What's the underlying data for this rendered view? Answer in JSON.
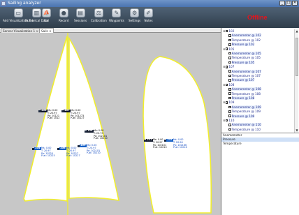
{
  "window": {
    "title": "Sailing analyzer"
  },
  "window_buttons": [
    "_",
    "□",
    "✕"
  ],
  "toolbar": {
    "items": [
      {
        "label": "Add Visualization Tab",
        "icon": "add-tab-icon",
        "glyph": "▭"
      },
      {
        "label": "Numerical Data",
        "icon": "columns-icon",
        "glyph": "▥"
      },
      {
        "label": "Sail",
        "icon": "sail-icon",
        "glyph": "⛵"
      },
      {
        "label": "Record",
        "icon": "record-icon",
        "glyph": "●"
      },
      {
        "label": "Sessions",
        "icon": "sessions-icon",
        "glyph": "▤"
      },
      {
        "label": "Calibration",
        "icon": "calibration-icon",
        "glyph": "⚖"
      },
      {
        "label": "Waypoints",
        "icon": "waypoints-icon",
        "glyph": "✎"
      },
      {
        "label": "Settings",
        "icon": "settings-icon",
        "glyph": "⚙"
      },
      {
        "label": "Notes",
        "icon": "notes-icon",
        "glyph": "✐"
      }
    ],
    "status": "Offline",
    "status_color": "#e8121b"
  },
  "tabs": [
    {
      "label": "Sensor Visualization 1",
      "close": "×",
      "active": false
    },
    {
      "label": "Sails",
      "close": "×",
      "active": true
    }
  ],
  "sail_color": "#f1ee2e",
  "sensors": [
    {
      "id": "105",
      "lines": [
        "Ms: 0.00",
        "T: 20.97",
        "Pa: 10121",
        "P-at: 1012"
      ],
      "highlight": false
    },
    {
      "id": "107",
      "lines": [
        "Ms: 0.00",
        "T: 20.97",
        "Pa: 101273",
        "P-at: 10127"
      ],
      "highlight": false
    },
    {
      "id": "104",
      "lines": [
        "Ms: 0.00",
        "T: 20.97",
        "Pa: 10220",
        "P-at: 10225"
      ],
      "highlight": true
    },
    {
      "id": "106",
      "lines": [
        "Ms: 0.00",
        "T: 20.97",
        "Pa: 10227",
        "P-at: 10227"
      ],
      "highlight": true
    },
    {
      "id": "108",
      "lines": [
        "Ms: 0.00",
        "T: 20.70",
        "Pa: 102101",
        "P-at: 10210"
      ],
      "highlight": false
    },
    {
      "id": "109",
      "lines": [
        "Ms: 0.00",
        "T: 20.97",
        "Pa: 102101",
        "P-at: 10210"
      ],
      "highlight": true
    },
    {
      "id": "101",
      "lines": [
        "Ms: 0.00",
        "T: 20.97",
        "Pa: 102101",
        "P-at: 10210"
      ],
      "highlight": false
    },
    {
      "id": "102",
      "lines": [
        "Ms: 0.00",
        "T: 20.96",
        "Pa: 102166",
        "P-at: 10216"
      ],
      "highlight": true
    }
  ],
  "tree": [
    {
      "text": "102",
      "level": 0,
      "expander": "⊟",
      "sel": false
    },
    {
      "text": "Anemometer @ 102",
      "level": 1,
      "sel": true
    },
    {
      "text": "Temperature @ 102",
      "level": 1,
      "sel": false
    },
    {
      "text": "Pressure @ 102",
      "level": 1,
      "sel": true
    },
    {
      "text": "105",
      "level": 0,
      "expander": "⊟",
      "sel": false
    },
    {
      "text": "Anemometer @ 105",
      "level": 1,
      "sel": true
    },
    {
      "text": "Temperature @ 105",
      "level": 1,
      "sel": false
    },
    {
      "text": "Pressure @ 105",
      "level": 1,
      "sel": true
    },
    {
      "text": "107",
      "level": 0,
      "expander": "⊟",
      "sel": false
    },
    {
      "text": "Anemometer @ 107",
      "level": 1,
      "sel": true
    },
    {
      "text": "Temperature @ 107",
      "level": 1,
      "sel": false
    },
    {
      "text": "Pressure @ 107",
      "level": 1,
      "sel": true
    },
    {
      "text": "108",
      "level": 0,
      "expander": "⊟",
      "sel": false
    },
    {
      "text": "Anemometer @ 108",
      "level": 1,
      "sel": true
    },
    {
      "text": "Temperature @ 108",
      "level": 1,
      "sel": false
    },
    {
      "text": "Pressure @ 108",
      "level": 1,
      "sel": true
    },
    {
      "text": "109",
      "level": 0,
      "expander": "⊟",
      "sel": false
    },
    {
      "text": "Anemometer @ 109",
      "level": 1,
      "sel": true
    },
    {
      "text": "Temperature @ 109",
      "level": 1,
      "sel": false
    },
    {
      "text": "Pressure @ 109",
      "level": 1,
      "sel": true
    },
    {
      "text": "110",
      "level": 0,
      "expander": "⊟",
      "sel": false
    },
    {
      "text": "Anemometer @ 110",
      "level": 1,
      "sel": true
    },
    {
      "text": "Temperature @ 110",
      "level": 1,
      "sel": false
    }
  ],
  "properties": [
    {
      "text": "Anemometer",
      "sel": false
    },
    {
      "text": "Pressure",
      "sel": true
    },
    {
      "text": "Temperature",
      "sel": false
    }
  ]
}
